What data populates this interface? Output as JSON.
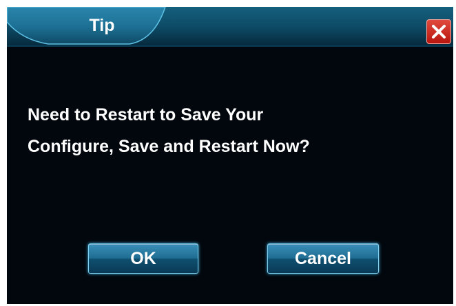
{
  "dialog": {
    "title": "Tip",
    "message_lines": [
      "Need to Restart to Save Your",
      "Configure, Save and Restart Now?"
    ],
    "close_icon": "close-icon"
  },
  "buttons": {
    "ok_label": "OK",
    "cancel_label": "Cancel"
  },
  "colors": {
    "background": "#02070d",
    "title_bar": "#0f5572",
    "title_tab": "#1c6f93",
    "close_button": "#c8281e",
    "button": "#1f6d93",
    "text": "#ffffff"
  }
}
